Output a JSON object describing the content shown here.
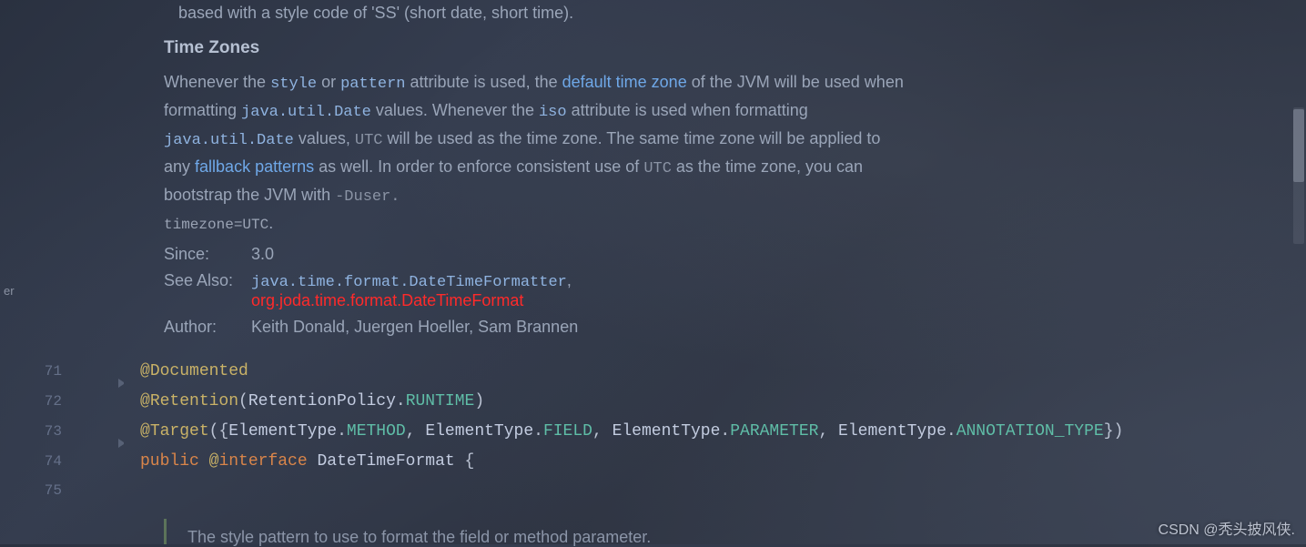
{
  "sidebar": {
    "fragment": "er"
  },
  "doc": {
    "line0": "based with a style code of 'SS' (short date, short time).",
    "heading_tz": "Time Zones",
    "para2_a": "Whenever the ",
    "style_code": "style",
    "para2_b": " or ",
    "pattern_code": "pattern",
    "para2_c": " attribute is used, the ",
    "link_dtz": "default time zone",
    "para2_d": " of the JVM will be used when formatting ",
    "jud": "java.util.Date",
    "para2_e": " values. Whenever the ",
    "iso_code": "iso",
    "para2_f": " attribute is used when formatting ",
    "para2_g": " values, ",
    "utc1": "UTC",
    "para2_h": " will be used as the time zone. The same time zone will be applied to any ",
    "link_fp": "fallback patterns",
    "para2_i": " as well. In order to enforce consistent use of ",
    "utc2": "UTC",
    "para2_j": " as the time zone, you can bootstrap the JVM with ",
    "duser": "-Duser.",
    "tz_tail": "timezone=UTC",
    "period": ".",
    "since_label": "Since:",
    "since_value": "3.0",
    "seealso_label": "See Also:",
    "seealso_1": "java.time.format.DateTimeFormatter",
    "seealso_comma": ",",
    "seealso_2": "org.joda.time.format.DateTimeFormat",
    "author_label": "Author:",
    "author_value": "Keith Donald, Juergen Hoeller, Sam Brannen",
    "tail": "The style pattern to use to format the field or method parameter."
  },
  "code": {
    "ln71": "71",
    "ln72": "72",
    "ln73": "73",
    "ln74": "74",
    "ln75": "75",
    "at": "@",
    "documented": "Documented",
    "retention": "Retention",
    "lp": "(",
    "rp": ")",
    "retention_policy": "RetentionPolicy",
    "dot": ".",
    "runtime": "RUNTIME",
    "target": "Target",
    "lb": "{",
    "rb": "}",
    "element_type": "ElementType",
    "m_method": "METHOD",
    "m_field": "FIELD",
    "m_param": "PARAMETER",
    "m_anno": "ANNOTATION_TYPE",
    "comma_sp": ", ",
    "public": "public ",
    "interface": "interface",
    "sp": " ",
    "class_name": "DateTimeFormat",
    "sp_lb": " {"
  },
  "watermark": "CSDN @秃头披风侠."
}
